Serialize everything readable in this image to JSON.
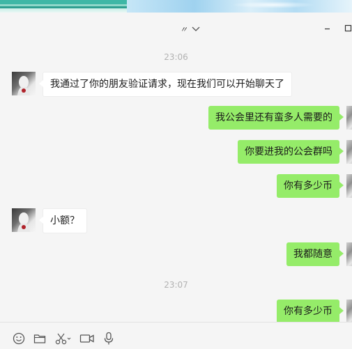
{
  "window": {
    "title": "〃",
    "title_dropdown_icon": "chevron-down-icon",
    "minimize_icon": "minimize-icon",
    "maximize_icon": "maximize-icon"
  },
  "colors": {
    "background": "#f5f5f5",
    "outgoing_bubble": "#95ec69",
    "incoming_bubble": "#ffffff",
    "timestamp": "#b2b2b2"
  },
  "messages": [
    {
      "type": "time",
      "text": "23:06"
    },
    {
      "type": "in",
      "text": "我通过了你的朋友验证请求，现在我们可以开始聊天了"
    },
    {
      "type": "out",
      "text": "我公会里还有蛮多人需要的"
    },
    {
      "type": "out",
      "text": "你要进我的公会群吗"
    },
    {
      "type": "out",
      "text": "你有多少币"
    },
    {
      "type": "in",
      "text": "小额？"
    },
    {
      "type": "out",
      "text": "我都随意"
    },
    {
      "type": "time",
      "text": "23:07"
    },
    {
      "type": "out",
      "text": "你有多少币"
    }
  ],
  "toolbar": {
    "items": [
      "emoji-icon",
      "folder-icon",
      "scissors-icon",
      "video-call-icon",
      "microphone-icon"
    ]
  }
}
